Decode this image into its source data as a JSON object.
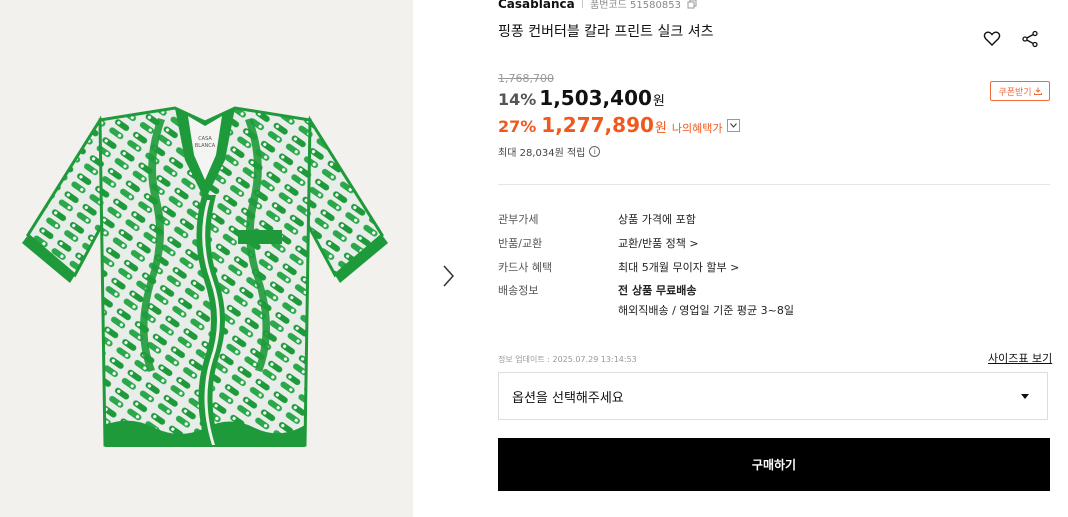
{
  "product": {
    "brand": "Casablanca",
    "code": "품번코드 51580853",
    "title": "핑퐁 컨버터블 칼라 프린트 실크 셔츠",
    "original_price": "1,768,700",
    "discount_pct": "14%",
    "price": "1,503,400",
    "won": "원",
    "sale_pct": "27%",
    "sale_price": "1,277,890",
    "my_benefit": "나의혜택가",
    "points": "최대 28,034원 적립",
    "coupon": "쿠폰받기"
  },
  "info": [
    {
      "label": "관부가세",
      "value": "상품 가격에 포함"
    },
    {
      "label": "반품/교환",
      "value": "교환/반품 정책 >"
    },
    {
      "label": "카드사 혜택",
      "value": "최대 5개월 무이자 할부 >"
    },
    {
      "label": "배송정보",
      "value": "전 상품 무료배송",
      "sub": "해외직배송 / 영업일 기준 평균 3~8일"
    }
  ],
  "update": "정보 업데이트 : 2025.07.29 13:14:53",
  "size_chart": "사이즈표 보기",
  "option_placeholder": "옵션을 선택해주세요",
  "buy": "구매하기",
  "colors": {
    "accent": "#f0581d",
    "shirt_green": "#1e9a3a"
  },
  "icons": [
    "heart-icon",
    "share-icon",
    "copy-icon",
    "download-icon",
    "info-icon",
    "chevron-right-icon",
    "chevron-down-icon"
  ]
}
